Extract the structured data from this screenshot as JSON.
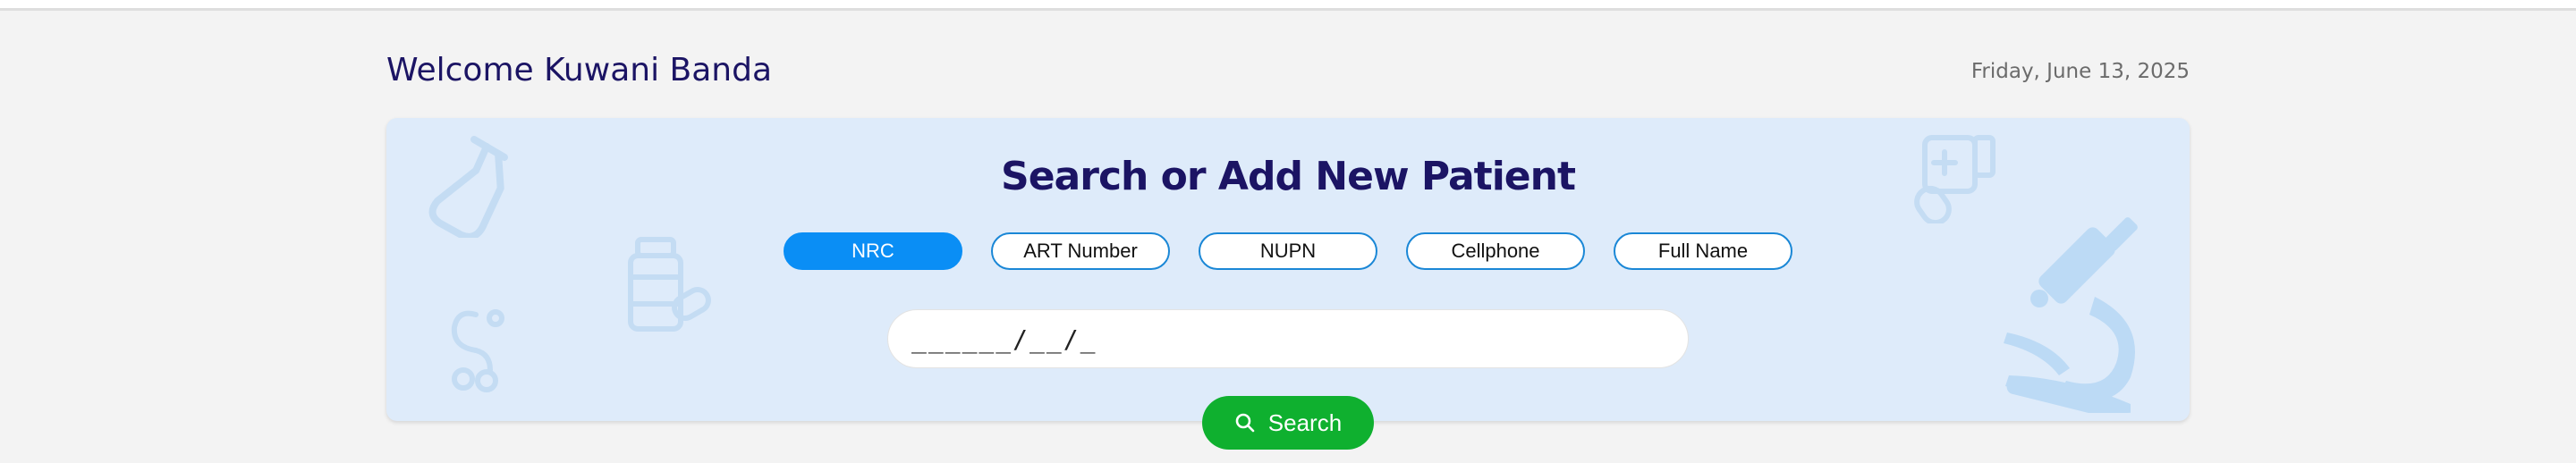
{
  "header": {
    "welcome": "Welcome Kuwani Banda",
    "date": "Friday, June 13, 2025"
  },
  "search_card": {
    "title": "Search or Add New Patient",
    "tabs": [
      {
        "label": "NRC",
        "active": true
      },
      {
        "label": "ART Number",
        "active": false
      },
      {
        "label": "NUPN",
        "active": false
      },
      {
        "label": "Cellphone",
        "active": false
      },
      {
        "label": "Full Name",
        "active": false
      }
    ],
    "input_value": "______/__/_",
    "search_label": "Search"
  },
  "colors": {
    "brand_navy": "#1b1464",
    "active_tab": "#0a8ef5",
    "search_green": "#0fb02f",
    "card_bg": "#deebfa"
  },
  "icons": [
    "flask-icon",
    "medicine-bottle-icon",
    "stethoscope-icon",
    "pills-bottle-icon",
    "microscope-icon",
    "search-icon"
  ]
}
